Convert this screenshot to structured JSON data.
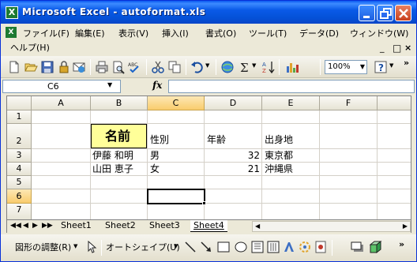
{
  "window": {
    "title": "Microsoft Excel - autoformat.xls",
    "app_icon_letter": "X"
  },
  "menu": {
    "items": [
      "ファイル(F)",
      "編集(E)",
      "表示(V)",
      "挿入(I)",
      "書式(O)",
      "ツール(T)",
      "データ(D)",
      "ウィンドウ(W)"
    ],
    "help": "ヘルプ(H)",
    "controls": [
      "_",
      "×"
    ]
  },
  "toolbar": {
    "zoom": "100%",
    "icons": [
      "new-icon",
      "open-icon",
      "save-icon",
      "permission-icon",
      "email-icon",
      "print-icon",
      "print-preview-icon",
      "spelling-icon",
      "cut-icon",
      "copy-icon",
      "undo-icon",
      "hyperlink-icon",
      "autosum-icon",
      "sort-ascending-icon",
      "chart-wizard-icon",
      "help-icon"
    ]
  },
  "formula_bar": {
    "name_box": "C6",
    "fx_label": "fx",
    "formula": ""
  },
  "sheet": {
    "columns": [
      "A",
      "B",
      "C",
      "D",
      "E",
      "F"
    ],
    "rows": [
      "1",
      "2",
      "3",
      "4",
      "5",
      "6",
      "7"
    ],
    "cells": {
      "B2": "名前",
      "C2": "性別",
      "D2": "年齢",
      "E2": "出身地",
      "B3": "伊藤 和明",
      "C3": "男",
      "D3": "32",
      "E3": "東京都",
      "B4": "山田 恵子",
      "C4": "女",
      "D4": "21",
      "E4": "沖縄県"
    },
    "active_cell": "C6",
    "header_highlight_color": "#ffff99"
  },
  "sheet_tabs": {
    "tabs": [
      "Sheet1",
      "Sheet2",
      "Sheet3",
      "Sheet4"
    ],
    "active": "Sheet4"
  },
  "drawing": {
    "draw_menu": "図形の調整(R)",
    "autoshapes": "オートシェイプ(U)"
  }
}
